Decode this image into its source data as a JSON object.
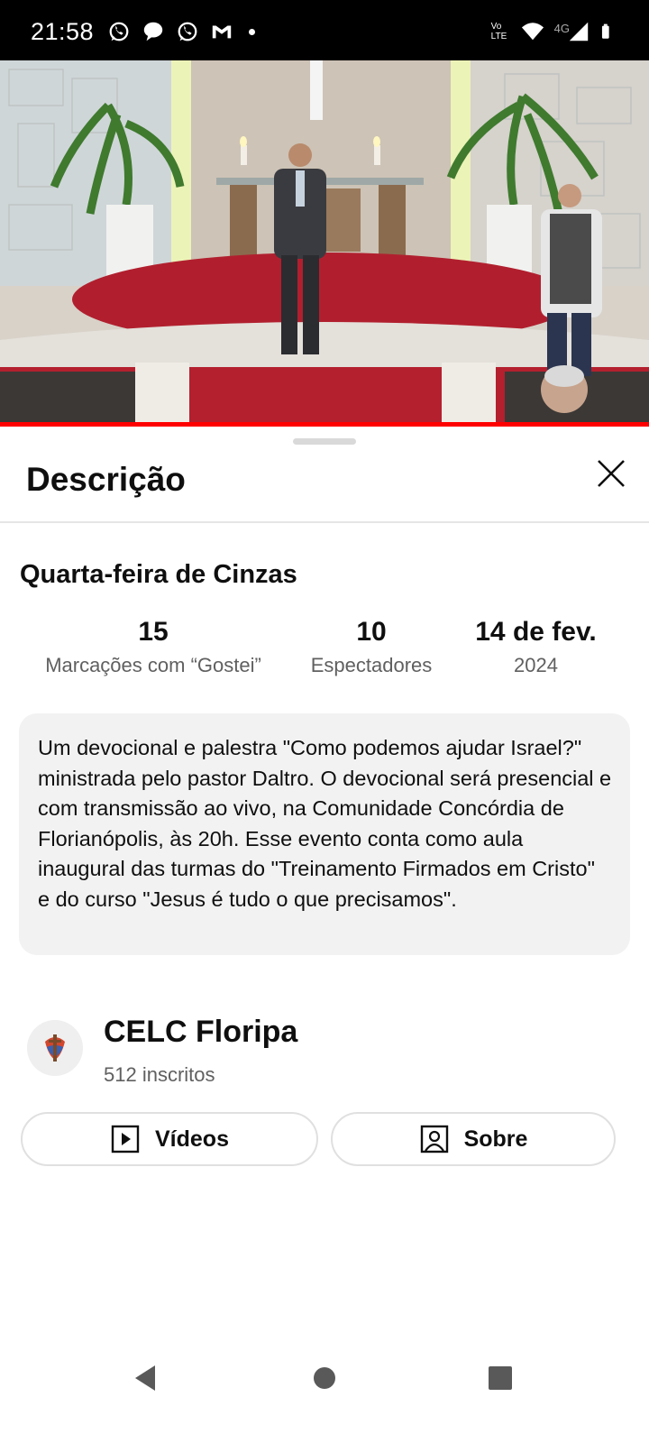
{
  "status_bar": {
    "time": "21:58",
    "left_icons": [
      "whatsapp-icon",
      "chat-bubble-icon",
      "whatsapp-icon",
      "gmail-icon",
      "notification-dot"
    ],
    "right_labels": {
      "volte": "Vo LTE",
      "network": "4G"
    }
  },
  "video": {
    "scene": "church-altar-live-stream",
    "progress_fraction": 1.0
  },
  "sheet": {
    "title": "Descrição"
  },
  "description": {
    "video_title": "Quarta-feira de Cinzas",
    "stats": [
      {
        "value": "15",
        "label": "Marcações com “Gostei”"
      },
      {
        "value": "10",
        "label": "Espectadores"
      },
      {
        "value": "14 de fev.",
        "label": "2024"
      }
    ],
    "text": "Um devocional e palestra \"Como podemos ajudar Israel?\" ministrada pelo pastor Daltro. O devocional será presencial e com transmissão ao vivo, na Comunidade Concórdia de Florianópolis, às 20h. Esse evento conta como aula inaugural das turmas do \"Treinamento Firmados em Cristo\" e do curso \"Jesus é tudo o que precisamos\"."
  },
  "channel": {
    "name": "CELC Floripa",
    "subscribers": "512 inscritos",
    "buttons": {
      "videos_label": "Vídeos",
      "about_label": "Sobre"
    }
  },
  "colors": {
    "accent_red": "#ff0000",
    "text_primary": "#0f0f0f",
    "text_secondary": "#606060",
    "box_bg": "#f2f2f2"
  }
}
